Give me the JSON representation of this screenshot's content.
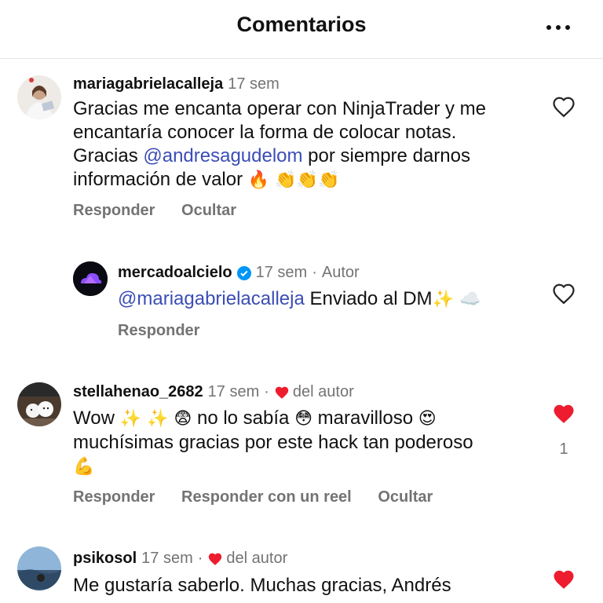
{
  "header": {
    "title": "Comentarios"
  },
  "comments": [
    {
      "username": "mariagabrielacalleja",
      "time": "17 sem",
      "text_lines": [
        "Gracias me encanta operar con NinjaTrader y me",
        "encantaría conocer la forma de colocar notas."
      ],
      "line3_pre": "Gracias ",
      "mention": "@andresagudelom",
      "line3_post": " por siempre darnos",
      "line4": "información de valor",
      "emojis": "🔥 👏👏👏",
      "actions": [
        "Responder",
        "Ocultar"
      ],
      "liked": false
    },
    {
      "username": "mercadoalcielo",
      "time": "17 sem",
      "dot": "·",
      "author_tag": "Autor",
      "mention": "@mariagabrielacalleja",
      "text": " Enviado al DM",
      "emojis": "✨ ☁️",
      "actions": [
        "Responder"
      ],
      "liked": false
    },
    {
      "username": "stellahenao_2682",
      "time": "17 sem",
      "dot": "·",
      "author_like": "del autor",
      "line1_a": "Wow ",
      "e1": "✨ ✨  😨",
      "line1_b": " no lo sabía ",
      "e2": "😳",
      "line1_c": " maravilloso ",
      "e3": "😍",
      "line2": "muchísimas gracias por este hack tan poderoso",
      "e4": "💪",
      "actions": [
        "Responder",
        "Responder con un reel",
        "Ocultar"
      ],
      "liked": true,
      "like_count": "1"
    },
    {
      "username": "psikosol",
      "time": "17 sem",
      "dot": "·",
      "author_like": "del autor",
      "text": "Me gustaría saberlo. Muchas gracias, Andrés",
      "liked": true
    }
  ],
  "colors": {
    "like_red": "#ed1c2e",
    "mention_blue": "#3b4db5",
    "muted": "#737373"
  }
}
